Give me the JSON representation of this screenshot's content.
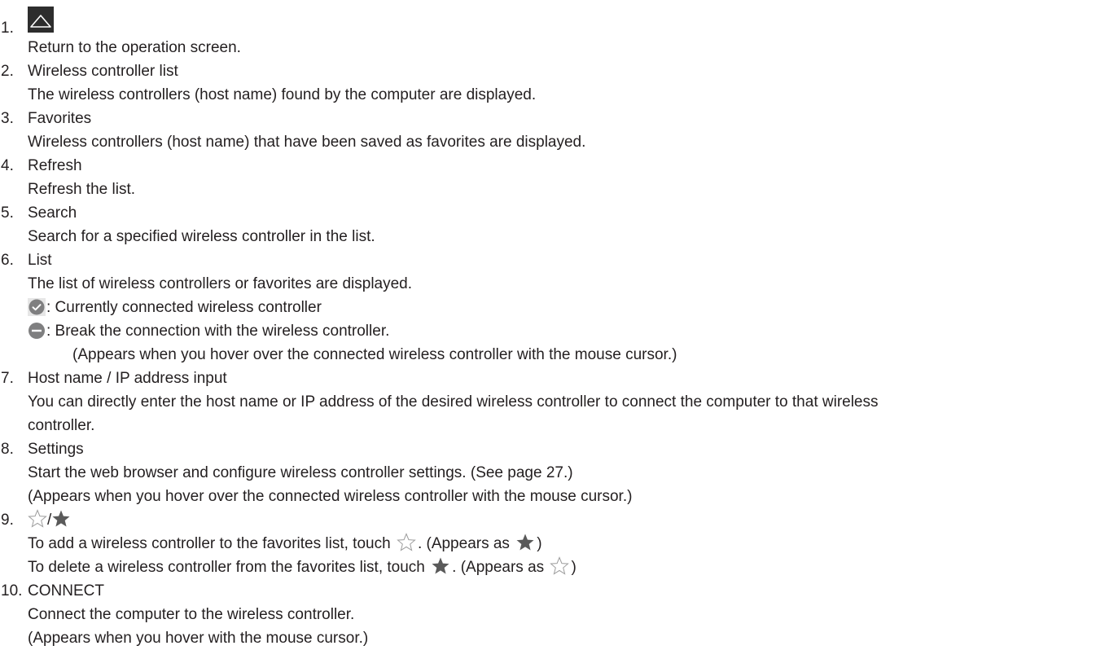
{
  "items": [
    {
      "num": "1.",
      "title": "",
      "icon": "up-triangle-icon",
      "desc": [
        "Return to the operation screen."
      ]
    },
    {
      "num": "2.",
      "title": "Wireless controller list",
      "desc": [
        "The wireless controllers (host name) found by the computer are displayed."
      ]
    },
    {
      "num": "3.",
      "title": "Favorites",
      "desc": [
        "Wireless controllers (host name) that have been saved as favorites are displayed."
      ]
    },
    {
      "num": "4.",
      "title": "Refresh",
      "desc": [
        "Refresh the list."
      ]
    },
    {
      "num": "5.",
      "title": "Search",
      "desc": [
        "Search for a specified wireless controller in the list."
      ]
    },
    {
      "num": "6.",
      "title": "List",
      "desc": [
        "The list of wireless controllers or favorites are displayed.",
        ": Currently connected wireless controller",
        ": Break the connection with the wireless controller.",
        "(Appears when you hover over the connected wireless controller with the mouse cursor.)"
      ],
      "icons": [
        "check-circle-icon",
        "minus-circle-icon"
      ]
    },
    {
      "num": "7.",
      "title": "Host name / IP address input",
      "desc": [
        "You can directly enter the host name or IP address of the desired wireless controller to connect the computer to that wireless",
        "controller."
      ]
    },
    {
      "num": "8.",
      "title": "Settings",
      "desc": [
        "Start the web browser and configure wireless controller settings. (See page 27.)",
        "(Appears when you hover over the connected wireless controller with the mouse cursor.)"
      ]
    },
    {
      "num": "9.",
      "title": "/",
      "icons": [
        "star-outline-icon",
        "star-filled-icon"
      ],
      "desc_parts": [
        [
          "To add a wireless controller to the favorites list, touch ",
          ". (Appears as ",
          ")"
        ],
        [
          "To delete a wireless controller from the favorites list, touch ",
          ". (Appears as ",
          ")"
        ]
      ]
    },
    {
      "num": "10.",
      "title": "CONNECT",
      "desc": [
        "Connect the computer to the wireless controller.",
        "(Appears when you hover with the mouse cursor.)"
      ]
    }
  ],
  "colors": {
    "text": "#231f20",
    "icon_dark": "#2d2d2d",
    "icon_gray": "#7f7f80",
    "check_bg": "#e6e6e6"
  }
}
